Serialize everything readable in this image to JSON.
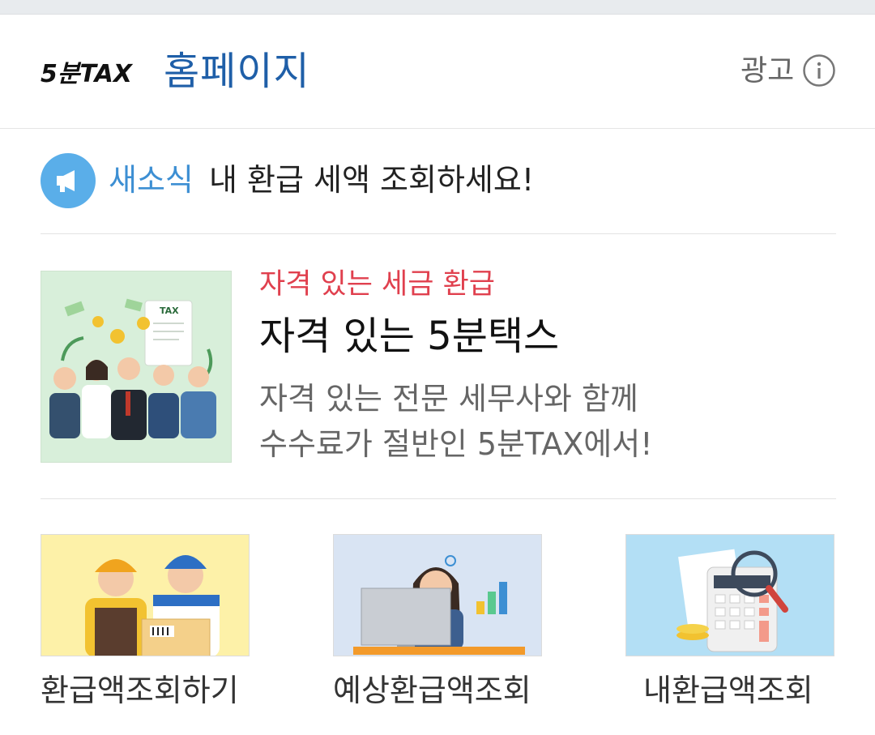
{
  "header": {
    "logo_text": "5분TAX",
    "homepage_label": "홈페이지",
    "ad_label": "광고",
    "info_icon": "info-circle-icon"
  },
  "news": {
    "icon": "megaphone-icon",
    "tag": "새소식",
    "text": "내 환급 세액 조회하세요!"
  },
  "promo": {
    "image_text": "TAX",
    "subtitle": "자격 있는 세금 환급",
    "title": "자격 있는 5분택스",
    "description": [
      "자격 있는 전문 세무사와 함께",
      "수수료가 절반인 5분TAX에서!"
    ]
  },
  "tiles": [
    {
      "label": "환급액조회하기"
    },
    {
      "label": "예상환급액조회"
    },
    {
      "label": "내환급액조회"
    }
  ],
  "colors": {
    "brand_blue": "#1f5fa8",
    "news_blue": "#3d8fd3",
    "accent_red": "#e0404e"
  }
}
